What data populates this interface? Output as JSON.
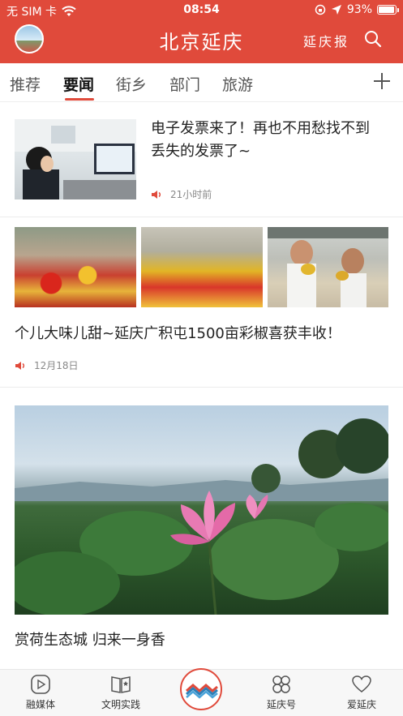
{
  "status_bar": {
    "carrier": "无 SIM 卡",
    "time": "08:54",
    "battery": "93%",
    "battery_level": 0.93
  },
  "app_bar": {
    "title": "北京延庆",
    "paper_link": "延庆报"
  },
  "tabs": [
    {
      "label": "推荐"
    },
    {
      "label": "要闻",
      "active": true
    },
    {
      "label": "街乡"
    },
    {
      "label": "部门"
    },
    {
      "label": "旅游"
    }
  ],
  "articles": [
    {
      "title_line1": "电子发票来了！再也不用愁找不到",
      "title_line2": "丢失的发票了~",
      "time": "21小时前"
    },
    {
      "title": "个儿大味儿甜~延庆广积屯1500亩彩椒喜获丰收！",
      "time": "12月18日"
    },
    {
      "title": "赏荷生态城 归来一身香"
    }
  ],
  "bottom_nav": [
    {
      "label": "融媒体",
      "icon": "play-icon"
    },
    {
      "label": "文明实践",
      "icon": "book-icon"
    },
    {
      "label": "",
      "icon": "home-logo-icon"
    },
    {
      "label": "延庆号",
      "icon": "clover-icon"
    },
    {
      "label": "爱延庆",
      "icon": "heart-icon"
    }
  ],
  "colors": {
    "brand": "#e04a3b",
    "tab_underline": "#e04a3b",
    "speaker": "#e04a3b"
  }
}
